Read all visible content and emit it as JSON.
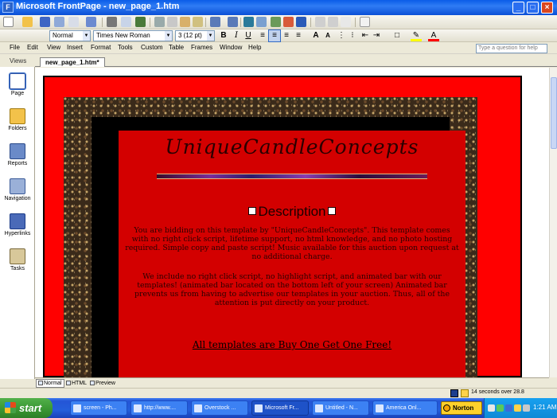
{
  "window": {
    "app_icon": "frontpage-icon",
    "title": "Microsoft FrontPage - new_page_1.htm",
    "minimize_label": "_",
    "maximize_label": "□",
    "close_label": "×"
  },
  "formatting": {
    "style": "Normal",
    "font": "Times New Roman",
    "size": "3 (12 pt)"
  },
  "menu": [
    "File",
    "Edit",
    "View",
    "Insert",
    "Format",
    "Tools",
    "Custom",
    "Table",
    "Frames",
    "Window",
    "Help"
  ],
  "help_placeholder": "Type a question for help",
  "views": {
    "header": "Views",
    "items": [
      {
        "label": "Page",
        "icon": "page-view-icon"
      },
      {
        "label": "Folders",
        "icon": "folders-view-icon"
      },
      {
        "label": "Reports",
        "icon": "reports-view-icon"
      },
      {
        "label": "Navigation",
        "icon": "navigation-view-icon"
      },
      {
        "label": "Hyperlinks",
        "icon": "hyperlinks-view-icon"
      },
      {
        "label": "Tasks",
        "icon": "tasks-view-icon"
      }
    ]
  },
  "document": {
    "tab_label": "new_page_1.htm*",
    "site_title": "UniqueCandleConcepts",
    "heading": "Description",
    "paragraph1": "You are bidding on this template by \"UniqueCandleConcepts\". This template comes with no right click script, lifetime support, no html knowledge, and no photo hosting required. Simple copy and paste script! Music available for this auction upon request at no additional charge.",
    "paragraph2": "We include no right click script, no highlight script, and animated bar with our templates! (animated bar located on the bottom left of your screen) Animated bar prevents us from having to advertise our templates in your auction. Thus, all of the attention is put directly on your product.",
    "promo_link": "All templates are Buy One Get One Free!"
  },
  "view_tabs": {
    "normal": "Normal",
    "html": "HTML",
    "preview": "Preview"
  },
  "status": {
    "download_time": "14 seconds over 28.8"
  },
  "taskbar": {
    "start_label": "start",
    "tasks": [
      "screen - Ph...",
      "http://www....",
      "Overstock ...",
      "Microsoft Fr...",
      "Untitled - N...",
      "America Onl..."
    ],
    "norton_label": "Norton",
    "clock": "1:21 AM"
  }
}
